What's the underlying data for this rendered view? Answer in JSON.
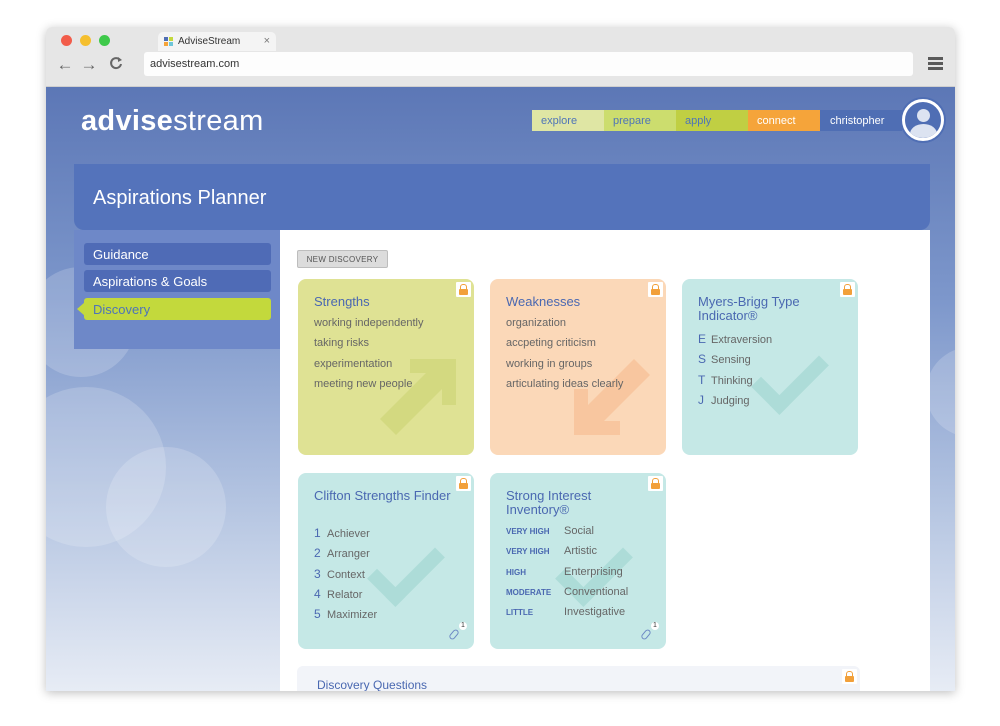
{
  "browser": {
    "tab_title": "AdviseStream",
    "tab_close": "×",
    "url": "advisestream.com",
    "back": "←",
    "forward": "→",
    "reload": "C"
  },
  "app": {
    "logo_bold": "advise",
    "logo_light": "stream",
    "nav": [
      "explore",
      "prepare",
      "apply",
      "connect"
    ],
    "user": "christopher",
    "page_title": "Aspirations Planner"
  },
  "sidebar": {
    "items": [
      "Guidance",
      "Aspirations & Goals",
      "Discovery"
    ]
  },
  "main": {
    "new_discovery": "NEW DISCOVERY",
    "strengths": {
      "title": "Strengths",
      "items": [
        "working independently",
        "taking risks",
        "experimentation",
        "meeting new people"
      ]
    },
    "weaknesses": {
      "title": "Weaknesses",
      "items": [
        "organization",
        "accpeting criticism",
        "working in groups",
        "articulating ideas clearly"
      ]
    },
    "myers": {
      "title": "Myers-Brigg Type Indicator®",
      "items": [
        {
          "k": "E",
          "v": "Extraversion"
        },
        {
          "k": "S",
          "v": "Sensing"
        },
        {
          "k": "T",
          "v": "Thinking"
        },
        {
          "k": "J",
          "v": "Judging"
        }
      ]
    },
    "clifton": {
      "title": "Clifton Strengths Finder",
      "items": [
        {
          "k": "1",
          "v": "Achiever"
        },
        {
          "k": "2",
          "v": "Arranger"
        },
        {
          "k": "3",
          "v": "Context"
        },
        {
          "k": "4",
          "v": "Relator"
        },
        {
          "k": "5",
          "v": "Maximizer"
        }
      ],
      "attachments": "1"
    },
    "strong": {
      "title": "Strong Interest Inventory®",
      "items": [
        {
          "k": "VERY HIGH",
          "v": "Social"
        },
        {
          "k": "VERY HIGH",
          "v": "Artistic"
        },
        {
          "k": "HIGH",
          "v": "Enterprising"
        },
        {
          "k": "MODERATE",
          "v": "Conventional"
        },
        {
          "k": "LITTLE",
          "v": "Investigative"
        }
      ],
      "attachments": "1"
    },
    "discovery_questions": "Discovery Questions"
  },
  "colors": {
    "strengths_bg": "#dfe294",
    "weaknesses_bg": "#fbd8b8",
    "assessment_bg": "#c5e8e6",
    "brand_blue": "#5473bb",
    "accent_green": "#c3d93c",
    "accent_orange": "#f5a43a"
  }
}
